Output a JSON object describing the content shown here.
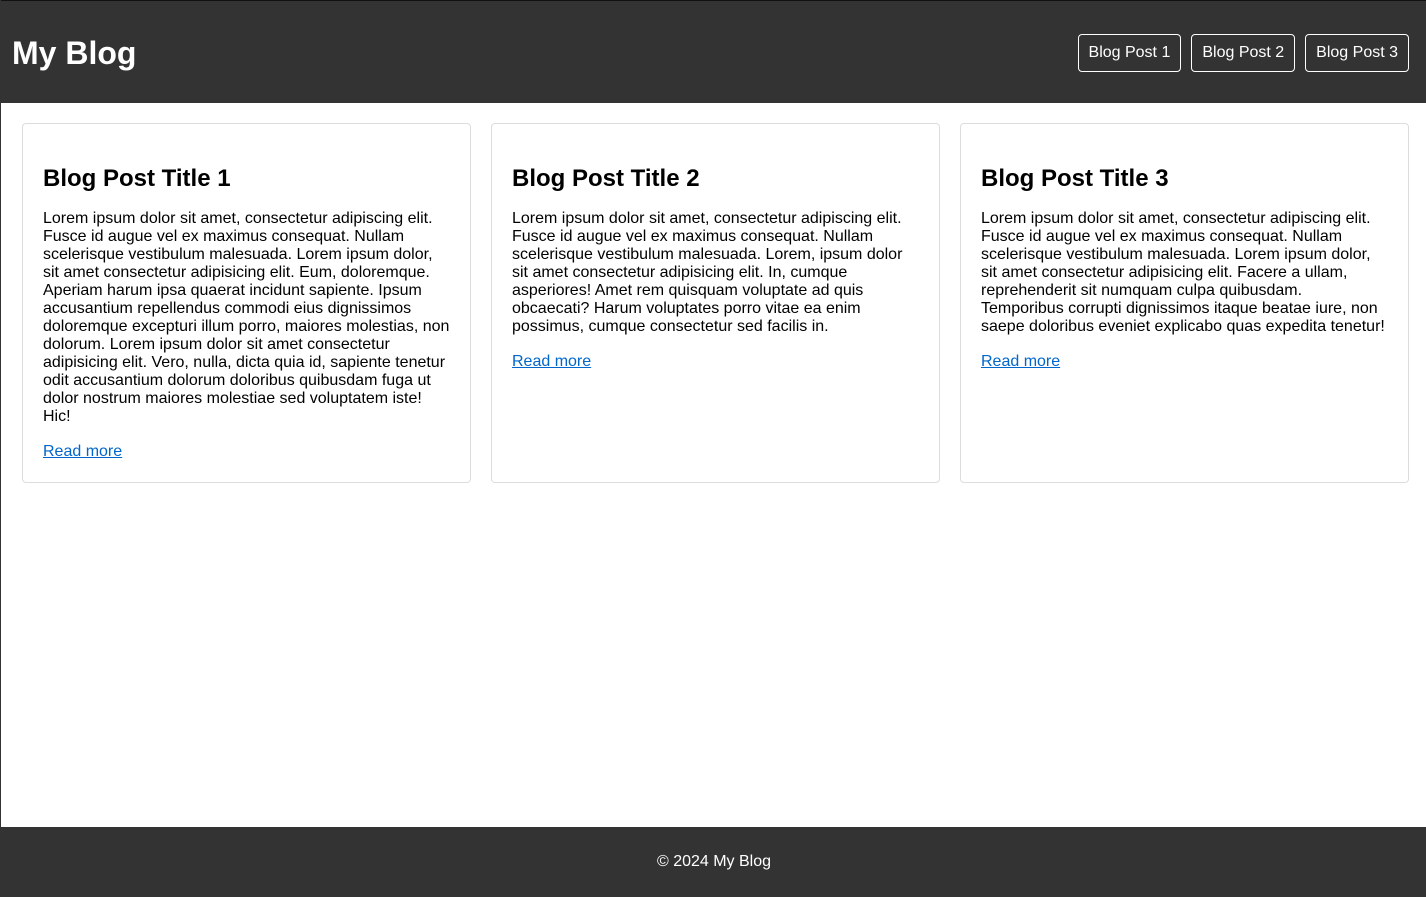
{
  "header": {
    "title": "My Blog",
    "nav": [
      {
        "label": "Blog Post 1"
      },
      {
        "label": "Blog Post 2"
      },
      {
        "label": "Blog Post 3"
      }
    ]
  },
  "posts": [
    {
      "title": "Blog Post Title 1",
      "body": "Lorem ipsum dolor sit amet, consectetur adipiscing elit. Fusce id augue vel ex maximus consequat. Nullam scelerisque vestibulum malesuada. Lorem ipsum dolor, sit amet consectetur adipisicing elit. Eum, doloremque. Aperiam harum ipsa quaerat incidunt sapiente. Ipsum accusantium repellendus commodi eius dignissimos doloremque excepturi illum porro, maiores molestias, non dolorum. Lorem ipsum dolor sit amet consectetur adipisicing elit. Vero, nulla, dicta quia id, sapiente tenetur odit accusantium dolorum doloribus quibusdam fuga ut dolor nostrum maiores molestiae sed voluptatem iste! Hic!",
      "link": "Read more"
    },
    {
      "title": "Blog Post Title 2",
      "body": "Lorem ipsum dolor sit amet, consectetur adipiscing elit. Fusce id augue vel ex maximus consequat. Nullam scelerisque vestibulum malesuada. Lorem, ipsum dolor sit amet consectetur adipisicing elit. In, cumque asperiores! Amet rem quisquam voluptate ad quis obcaecati? Harum voluptates porro vitae ea enim possimus, cumque consectetur sed facilis in.",
      "link": "Read more"
    },
    {
      "title": "Blog Post Title 3",
      "body": "Lorem ipsum dolor sit amet, consectetur adipiscing elit. Fusce id augue vel ex maximus consequat. Nullam scelerisque vestibulum malesuada. Lorem ipsum dolor, sit amet consectetur adipisicing elit. Facere a ullam, reprehenderit sit numquam culpa quibusdam. Temporibus corrupti dignissimos itaque beatae iure, non saepe doloribus eveniet explicabo quas expedita tenetur!",
      "link": "Read more"
    }
  ],
  "footer": {
    "text": "© 2024 My Blog"
  },
  "colors": {
    "header_bg": "#333333",
    "link": "#0066cc",
    "card_border": "#dddddd"
  }
}
